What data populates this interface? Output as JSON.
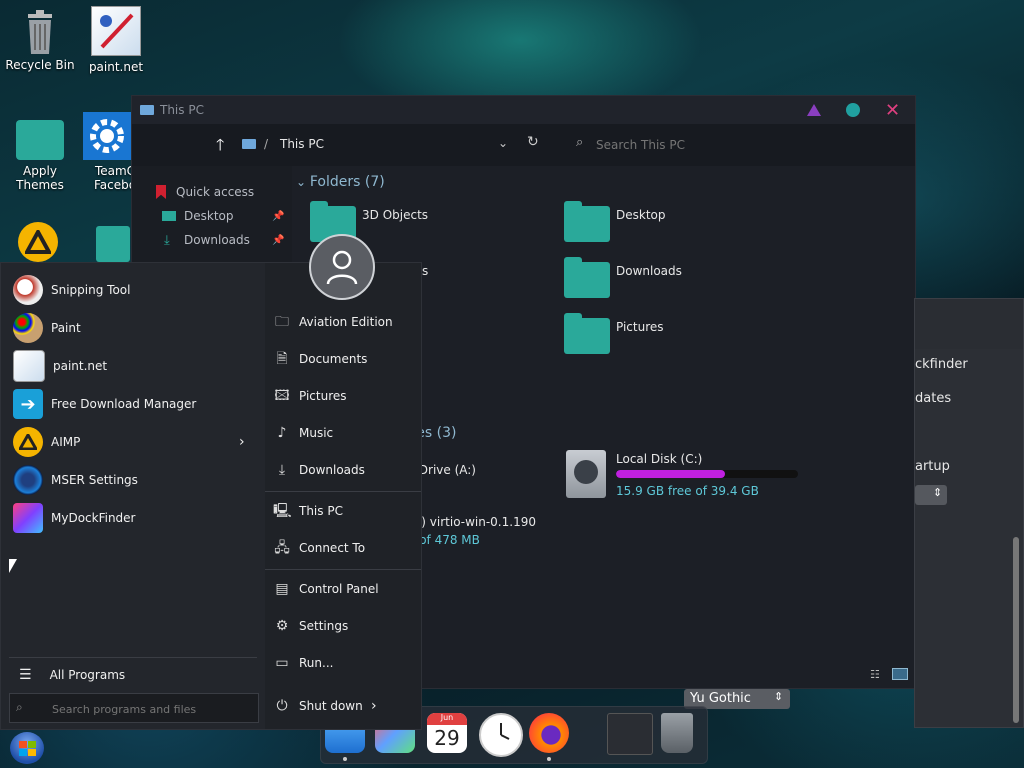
{
  "desktop": {
    "icons": [
      {
        "label": "Recycle Bin"
      },
      {
        "label": "paint.net"
      },
      {
        "label": "Apply Themes"
      },
      {
        "label": "TeamC Facebo"
      }
    ]
  },
  "explorer": {
    "title": "This PC",
    "breadcrumb_sep": "/",
    "breadcrumb": "This PC",
    "search_placeholder": "Search This PC",
    "sidebar": [
      "Quick access",
      "Desktop",
      "Downloads"
    ],
    "folders_header": "Folders (7)",
    "folders": [
      "3D Objects",
      "Desktop",
      "Downloads",
      "Pictures"
    ],
    "folders_partial": "s",
    "drives_header_partial": "ves (3)",
    "drives": {
      "floppy": "k Drive (A:)",
      "cd_name": "D:) virtio-win-0.1.190",
      "cd_free": "e of 478 MB",
      "local_name": "Local Disk (C:)",
      "local_free": "15.9 GB free of 39.4 GB",
      "local_used_fraction": 0.6
    }
  },
  "right_panel": {
    "line1": "ckfinder",
    "line2": "dates",
    "line3": "artup",
    "font_select": "Yu Gothic"
  },
  "start_menu": {
    "apps": [
      {
        "label": "Snipping Tool",
        "icon": "snipping-tool-icon"
      },
      {
        "label": "Paint",
        "icon": "paint-icon"
      },
      {
        "label": "paint.net",
        "icon": "paintnet-icon"
      },
      {
        "label": "Free Download Manager",
        "icon": "fdm-icon"
      },
      {
        "label": "AIMP",
        "icon": "aimp-icon"
      },
      {
        "label": "MSER Settings",
        "icon": "mser-icon"
      },
      {
        "label": "MyDockFinder",
        "icon": "mydockfinder-icon"
      }
    ],
    "all_programs": "All Programs",
    "search_placeholder": "Search programs and files",
    "links": [
      "Aviation Edition",
      "Documents",
      "Pictures",
      "Music",
      "Downloads",
      "This PC",
      "Connect To",
      "Control Panel",
      "Settings",
      "Run..."
    ],
    "shutdown": "Shut down"
  },
  "dock": {
    "calendar_month": "Jun",
    "calendar_day": "29"
  },
  "colors": {
    "accent_teal": "#2aa99a",
    "progress_purple": "#c020e0",
    "title_triangle": "#8a3ec0",
    "title_circle": "#20a0a0",
    "title_close": "#e04080"
  }
}
